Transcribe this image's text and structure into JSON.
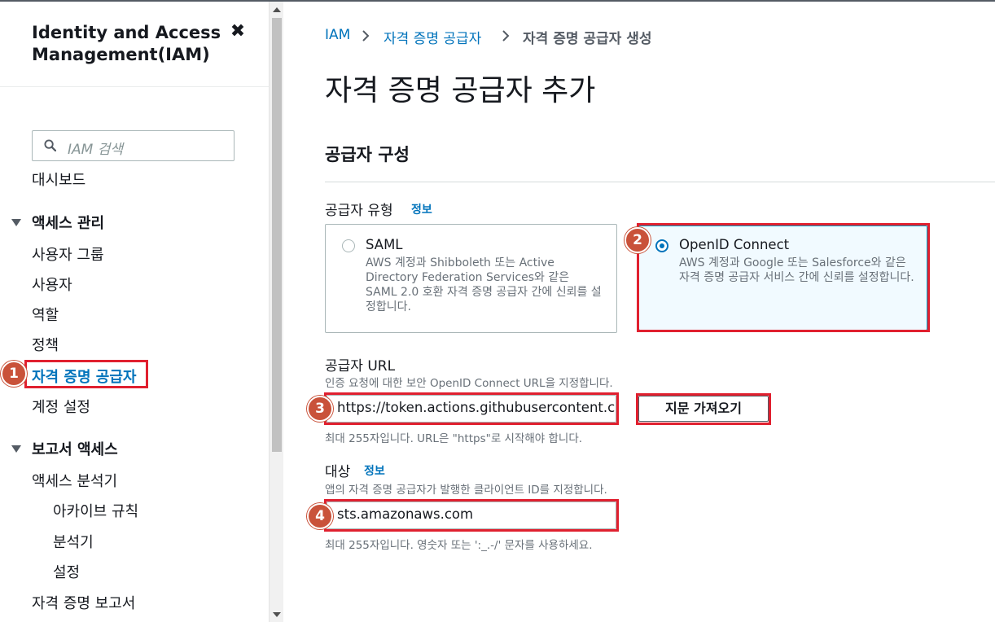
{
  "sidebar": {
    "title_line1": "Identity and Access",
    "title_line2": "Management(IAM)",
    "search_placeholder": "IAM 검색",
    "dashboard": "대시보드",
    "access_mgmt": "액세스 관리",
    "user_groups": "사용자 그룹",
    "users": "사용자",
    "roles": "역할",
    "policies": "정책",
    "identity_providers": "자격 증명 공급자",
    "account_settings": "계정 설정",
    "reports_access": "보고서 액세스",
    "access_analyzer": "액세스 분석기",
    "archive_rules": "아카이브 규칙",
    "analyzers": "분석기",
    "settings": "설정",
    "credential_report": "자격 증명 보고서"
  },
  "breadcrumb": {
    "iam": "IAM",
    "providers": "자격 증명 공급자",
    "current": "자격 증명 공급자 생성"
  },
  "main": {
    "page_title": "자격 증명 공급자 추가",
    "section_title": "공급자 구성",
    "provider_type_label": "공급자 유형",
    "info_link": "정보",
    "saml": {
      "title": "SAML",
      "desc": "AWS 계정과 Shibboleth 또는 Active Directory Federation Services와 같은 SAML 2.0 호환 자격 증명 공급자 간에 신뢰를 설정합니다."
    },
    "oidc": {
      "title": "OpenID Connect",
      "desc": "AWS 계정과 Google 또는 Salesforce와 같은 자격 증명 공급자 서비스 간에 신뢰를 설정합니다."
    },
    "provider_url_label": "공급자 URL",
    "provider_url_desc": "인증 요청에 대한 보안 OpenID Connect URL을 지정합니다.",
    "provider_url_value": "https://token.actions.githubusercontent.com",
    "get_thumbprint": "지문 가져오기",
    "provider_url_hint": "최대 255자입니다. URL은 \"https\"로 시작해야 합니다.",
    "audience_label": "대상",
    "audience_info": "정보",
    "audience_desc": "앱의 자격 증명 공급자가 발행한 클라이언트 ID를 지정합니다.",
    "audience_value": "sts.amazonaws.com",
    "audience_hint": "최대 255자입니다. 영숫자 또는 ':_.-/' 문자를 사용하세요."
  },
  "badges": {
    "b1": "1",
    "b2": "2",
    "b3": "3",
    "b4": "4"
  },
  "colors": {
    "link": "#0073bb",
    "highlight": "#e0202f",
    "badge": "#c9523a",
    "selected_tile_bg": "#f1faff"
  }
}
